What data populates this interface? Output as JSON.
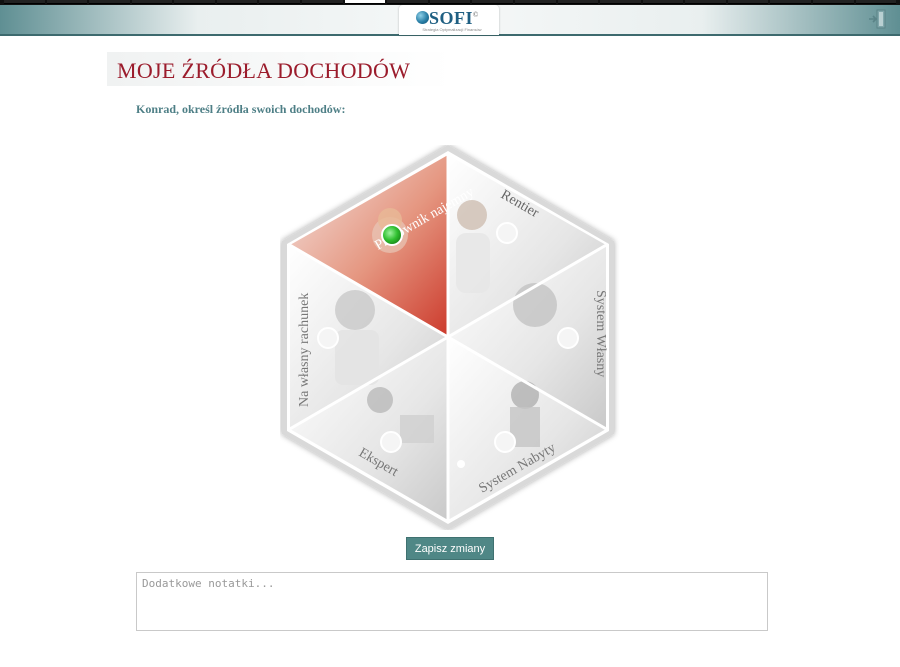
{
  "progress": {
    "segments": 21,
    "active_index": 8
  },
  "header": {
    "logo_text": "SOFI",
    "logo_mark": "©",
    "logo_subtitle": "Strategia Optymalizacji Finansów"
  },
  "page": {
    "title": "MOJE ŹRÓDŁA DOCHODÓW",
    "question": "Konrad, określ źródła swoich dochodów:"
  },
  "hexagon": {
    "segments": [
      {
        "label": "Pracownik najemny",
        "selected": true
      },
      {
        "label": "Rentier",
        "selected": false
      },
      {
        "label": "System Własny",
        "selected": false
      },
      {
        "label": "System Nabyty",
        "selected": false
      },
      {
        "label": "Ekspert",
        "selected": false
      },
      {
        "label": "Na własny rachunek",
        "selected": false
      }
    ]
  },
  "actions": {
    "save_label": "Zapisz zmiany"
  },
  "notes": {
    "placeholder": "Dodatkowe notatki..."
  },
  "colors": {
    "accent": "#4f8786",
    "title": "#9b1c2c",
    "question": "#4e7f86",
    "selected": "#3fbf3f"
  }
}
